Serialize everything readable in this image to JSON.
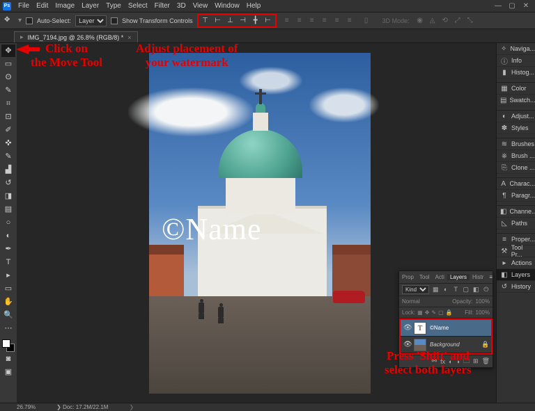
{
  "menu": {
    "items": [
      "File",
      "Edit",
      "Image",
      "Layer",
      "Type",
      "Select",
      "Filter",
      "3D",
      "View",
      "Window",
      "Help"
    ]
  },
  "options": {
    "auto_select_label": "Auto-Select:",
    "auto_select_value": "Layer",
    "show_transform_label": "Show Transform Controls",
    "threed_label": "3D Mode:"
  },
  "tab": {
    "title": "IMG_7194.jpg @ 26.8% (RGB/8) *"
  },
  "watermark": "©Name",
  "right_panels": [
    {
      "icon": "✧",
      "label": "Naviga..."
    },
    {
      "icon": "ⓘ",
      "label": "Info"
    },
    {
      "icon": "▮",
      "label": "Histog..."
    },
    {
      "gap": true
    },
    {
      "icon": "▦",
      "label": "Color"
    },
    {
      "icon": "▤",
      "label": "Swatch..."
    },
    {
      "gap": true
    },
    {
      "icon": "◐",
      "label": "Adjust..."
    },
    {
      "icon": "✽",
      "label": "Styles"
    },
    {
      "gap": true
    },
    {
      "icon": "≋",
      "label": "Brushes"
    },
    {
      "icon": "⎈",
      "label": "Brush ..."
    },
    {
      "icon": "⎘",
      "label": "Clone ..."
    },
    {
      "gap": true
    },
    {
      "icon": "A",
      "label": "Charac..."
    },
    {
      "icon": "¶",
      "label": "Paragr..."
    },
    {
      "gap": true
    },
    {
      "icon": "◧",
      "label": "Channe..."
    },
    {
      "icon": "◺",
      "label": "Paths"
    },
    {
      "gap": true
    },
    {
      "icon": "≡",
      "label": "Proper..."
    },
    {
      "icon": "⚒",
      "label": "Tool Pr..."
    },
    {
      "icon": "▸",
      "label": "Actions"
    },
    {
      "icon": "◧",
      "label": "Layers",
      "sel": true
    },
    {
      "icon": "↺",
      "label": "History"
    }
  ],
  "layers_panel": {
    "tabs": [
      "Prop",
      "Tool",
      "Acti",
      "Layers",
      "Histr"
    ],
    "active_tab": "Layers",
    "kind_label": "Kind",
    "blend_mode": "Normal",
    "opacity_label": "Opacity:",
    "opacity_value": "100%",
    "lock_label": "Lock:",
    "fill_label": "Fill:",
    "fill_value": "100%",
    "layers": [
      {
        "name": "©Name",
        "type": "text",
        "selected": true,
        "locked": false
      },
      {
        "name": "Background",
        "type": "image",
        "selected": false,
        "locked": true
      }
    ]
  },
  "annotations": {
    "move_tool": "Click on\nthe Move Tool",
    "align": "Adjust placement of\nyour watermark",
    "shift": "Press 'Shift' and\nselect both layers"
  },
  "status": {
    "zoom": "26.79%",
    "doc": "Doc: 17.2M/22.1M"
  }
}
